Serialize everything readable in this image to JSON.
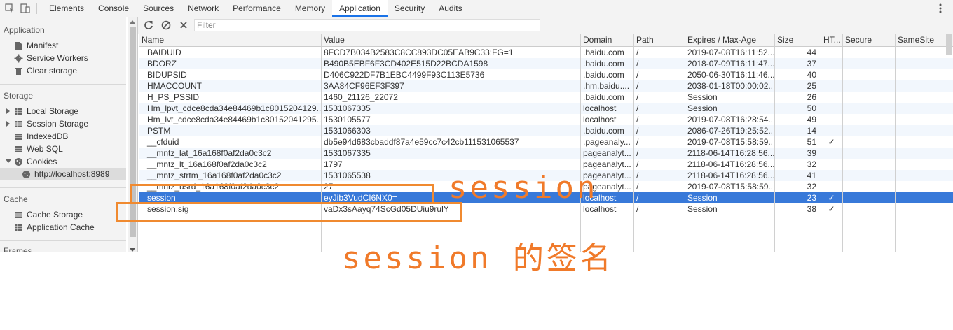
{
  "topbar": {
    "tabs": [
      "Elements",
      "Console",
      "Sources",
      "Network",
      "Performance",
      "Memory",
      "Application",
      "Security",
      "Audits"
    ],
    "active_tab": "Application"
  },
  "sidebar": {
    "sections": [
      {
        "title": "Application",
        "items": [
          "Manifest",
          "Service Workers",
          "Clear storage"
        ]
      },
      {
        "title": "Storage",
        "items": [
          "Local Storage",
          "Session Storage",
          "IndexedDB",
          "Web SQL",
          "Cookies"
        ],
        "sub_item": "http://localhost:8989"
      },
      {
        "title": "Cache",
        "items": [
          "Cache Storage",
          "Application Cache"
        ]
      },
      {
        "title": "Frames"
      }
    ]
  },
  "toolbar": {
    "filter_placeholder": "Filter"
  },
  "table": {
    "columns": [
      "Name",
      "Value",
      "Domain",
      "Path",
      "Expires / Max-Age",
      "Size",
      "HT...",
      "Secure",
      "SameSite"
    ],
    "rows": [
      {
        "name": "BAIDUID",
        "value": "8FCD7B034B2583C8CC893DC05EAB9C33:FG=1",
        "domain": ".baidu.com",
        "path": "/",
        "expires": "2019-07-08T16:11:52...",
        "size": "44",
        "http": "",
        "secure": ""
      },
      {
        "name": "BDORZ",
        "value": "B490B5EBF6F3CD402E515D22BCDA1598",
        "domain": ".baidu.com",
        "path": "/",
        "expires": "2018-07-09T16:11:47...",
        "size": "37",
        "http": "",
        "secure": ""
      },
      {
        "name": "BIDUPSID",
        "value": "D406C922DF7B1EBC4499F93C113E5736",
        "domain": ".baidu.com",
        "path": "/",
        "expires": "2050-06-30T16:11:46...",
        "size": "40",
        "http": "",
        "secure": ""
      },
      {
        "name": "HMACCOUNT",
        "value": "3AA84CF96EF3F397",
        "domain": ".hm.baidu....",
        "path": "/",
        "expires": "2038-01-18T00:00:02...",
        "size": "25",
        "http": "",
        "secure": ""
      },
      {
        "name": "H_PS_PSSID",
        "value": "1460_21126_22072",
        "domain": ".baidu.com",
        "path": "/",
        "expires": "Session",
        "size": "26",
        "http": "",
        "secure": ""
      },
      {
        "name": "Hm_lpvt_cdce8cda34e84469b1c8015204129...",
        "value": "1531067335",
        "domain": "localhost",
        "path": "/",
        "expires": "Session",
        "size": "50",
        "http": "",
        "secure": ""
      },
      {
        "name": "Hm_lvt_cdce8cda34e84469b1c80152041295...",
        "value": "1530105577",
        "domain": "localhost",
        "path": "/",
        "expires": "2019-07-08T16:28:54...",
        "size": "49",
        "http": "",
        "secure": ""
      },
      {
        "name": "PSTM",
        "value": "1531066303",
        "domain": ".baidu.com",
        "path": "/",
        "expires": "2086-07-26T19:25:52...",
        "size": "14",
        "http": "",
        "secure": ""
      },
      {
        "name": "__cfduid",
        "value": "db5e94d683cbaddf87a4e59cc7c42cb111531065537",
        "domain": ".pageanaly...",
        "path": "/",
        "expires": "2019-07-08T15:58:59...",
        "size": "51",
        "http": "✓",
        "secure": ""
      },
      {
        "name": "__mntz_lat_16a168f0af2da0c3c2",
        "value": "1531067335",
        "domain": "pageanalyt...",
        "path": "/",
        "expires": "2118-06-14T16:28:56...",
        "size": "39",
        "http": "",
        "secure": ""
      },
      {
        "name": "__mntz_lt_16a168f0af2da0c3c2",
        "value": "1797",
        "domain": "pageanalyt...",
        "path": "/",
        "expires": "2118-06-14T16:28:56...",
        "size": "32",
        "http": "",
        "secure": ""
      },
      {
        "name": "__mntz_strtm_16a168f0af2da0c3c2",
        "value": "1531065538",
        "domain": "pageanalyt...",
        "path": "/",
        "expires": "2118-06-14T16:28:56...",
        "size": "41",
        "http": "",
        "secure": ""
      },
      {
        "name": "__mntz_usrd_16a168f0af2da0c3c2",
        "value": "27",
        "domain": "pageanalyt...",
        "path": "/",
        "expires": "2019-07-08T15:58:59...",
        "size": "32",
        "http": "",
        "secure": ""
      },
      {
        "name": "session",
        "value": "eyJib3VudCI6NX0=",
        "domain": "localhost",
        "path": "/",
        "expires": "Session",
        "size": "23",
        "http": "✓",
        "secure": ""
      },
      {
        "name": "session.sig",
        "value": "vaDx3sAayq74ScGd05DUiu9rulY",
        "domain": "localhost",
        "path": "/",
        "expires": "Session",
        "size": "38",
        "http": "✓",
        "secure": ""
      }
    ],
    "selected_row": 13
  },
  "annotations": {
    "session_label": "session",
    "signature_label": "session 的签名",
    "color": "#f08a30"
  }
}
